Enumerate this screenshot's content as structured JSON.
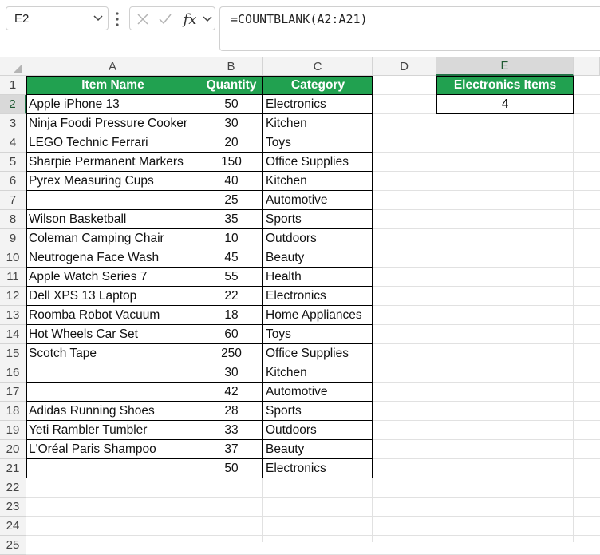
{
  "formula_bar": {
    "name_box": "E2",
    "formula": "=COUNTBLANK(A2:A21)",
    "fx_label": "fx"
  },
  "columns": [
    "A",
    "B",
    "C",
    "D",
    "E"
  ],
  "rows": [
    "1",
    "2",
    "3",
    "4",
    "5",
    "6",
    "7",
    "8",
    "9",
    "10",
    "11",
    "12",
    "13",
    "14",
    "15",
    "16",
    "17",
    "18",
    "19",
    "20",
    "21",
    "22",
    "23",
    "24",
    "25"
  ],
  "table": {
    "headers": [
      "Item Name",
      "Quantity",
      "Category"
    ],
    "rows": [
      [
        "Apple iPhone 13",
        "50",
        "Electronics"
      ],
      [
        "Ninja Foodi Pressure Cooker",
        "30",
        "Kitchen"
      ],
      [
        "LEGO Technic Ferrari",
        "20",
        "Toys"
      ],
      [
        "Sharpie Permanent Markers",
        "150",
        "Office Supplies"
      ],
      [
        "Pyrex Measuring Cups",
        "40",
        "Kitchen"
      ],
      [
        "",
        "25",
        "Automotive"
      ],
      [
        "Wilson Basketball",
        "35",
        "Sports"
      ],
      [
        "Coleman Camping Chair",
        "10",
        "Outdoors"
      ],
      [
        "Neutrogena Face Wash",
        "45",
        "Beauty"
      ],
      [
        "Apple Watch Series 7",
        "55",
        "Health"
      ],
      [
        "Dell XPS 13 Laptop",
        "22",
        "Electronics"
      ],
      [
        "Roomba Robot Vacuum",
        "18",
        "Home Appliances"
      ],
      [
        "Hot Wheels Car Set",
        "60",
        "Toys"
      ],
      [
        "Scotch Tape",
        "250",
        "Office Supplies"
      ],
      [
        "",
        "30",
        "Kitchen"
      ],
      [
        "",
        "42",
        "Automotive"
      ],
      [
        "Adidas Running Shoes",
        "28",
        "Sports"
      ],
      [
        "Yeti Rambler Tumbler",
        "33",
        "Outdoors"
      ],
      [
        "L'Oréal Paris Shampoo",
        "37",
        "Beauty"
      ],
      [
        "",
        "50",
        "Electronics"
      ]
    ]
  },
  "summary": {
    "header": "Electronics Items",
    "value": "4"
  },
  "colors": {
    "header_green": "#21a150",
    "selection_green": "#107c41"
  }
}
